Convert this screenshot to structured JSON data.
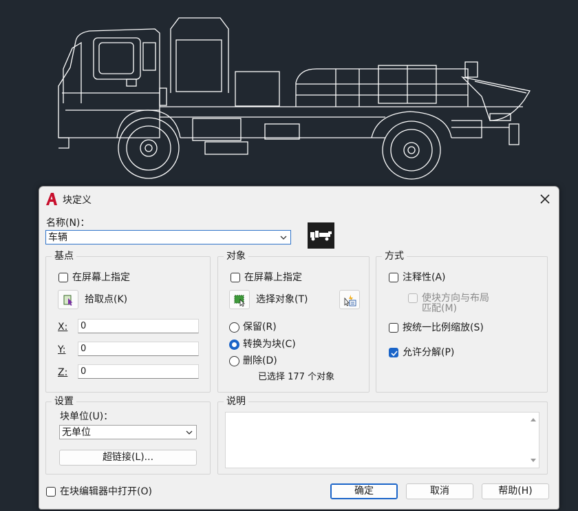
{
  "dialog": {
    "title": "块定义",
    "name_label": "名称(N)：",
    "name_value": "车辆",
    "basepoint": {
      "title": "基点",
      "specify_on_screen": "在屏幕上指定",
      "specify_checked": false,
      "pick_point": "拾取点(K)",
      "x_label": "X:",
      "y_label": "Y:",
      "z_label": "Z:",
      "x_value": "0",
      "y_value": "0",
      "z_value": "0"
    },
    "objects": {
      "title": "对象",
      "specify_on_screen": "在屏幕上指定",
      "specify_checked": false,
      "select_objects": "选择对象(T)",
      "retain": "保留(R)",
      "convert": "转换为块(C)",
      "delete": "删除(D)",
      "selected_option": "convert",
      "selected_count_text": "已选择 177 个对象"
    },
    "behavior": {
      "title": "方式",
      "annotative": "注释性(A)",
      "annotative_checked": false,
      "match_orientation_line1": "使块方向与布局",
      "match_orientation_line2": "匹配(M)",
      "match_orientation_checked": false,
      "scale_uniformly": "按统一比例缩放(S)",
      "scale_uniformly_checked": false,
      "allow_exploding": "允许分解(P)",
      "allow_exploding_checked": true
    },
    "settings": {
      "title": "设置",
      "block_unit_label": "块单位(U)：",
      "block_unit_value": "无单位",
      "hyperlink": "超链接(L)..."
    },
    "description": {
      "title": "说明",
      "value": ""
    },
    "open_in_editor": "在块编辑器中打开(O)",
    "open_in_editor_checked": false,
    "ok": "确定",
    "cancel": "取消",
    "help": "帮助(H)"
  },
  "colors": {
    "canvas_bg": "#212830",
    "drawing_lines": "#ffffff",
    "dialog_bg": "#f0f0f0",
    "accent": "#1a64c8",
    "autocad_red": "#c8102e"
  }
}
